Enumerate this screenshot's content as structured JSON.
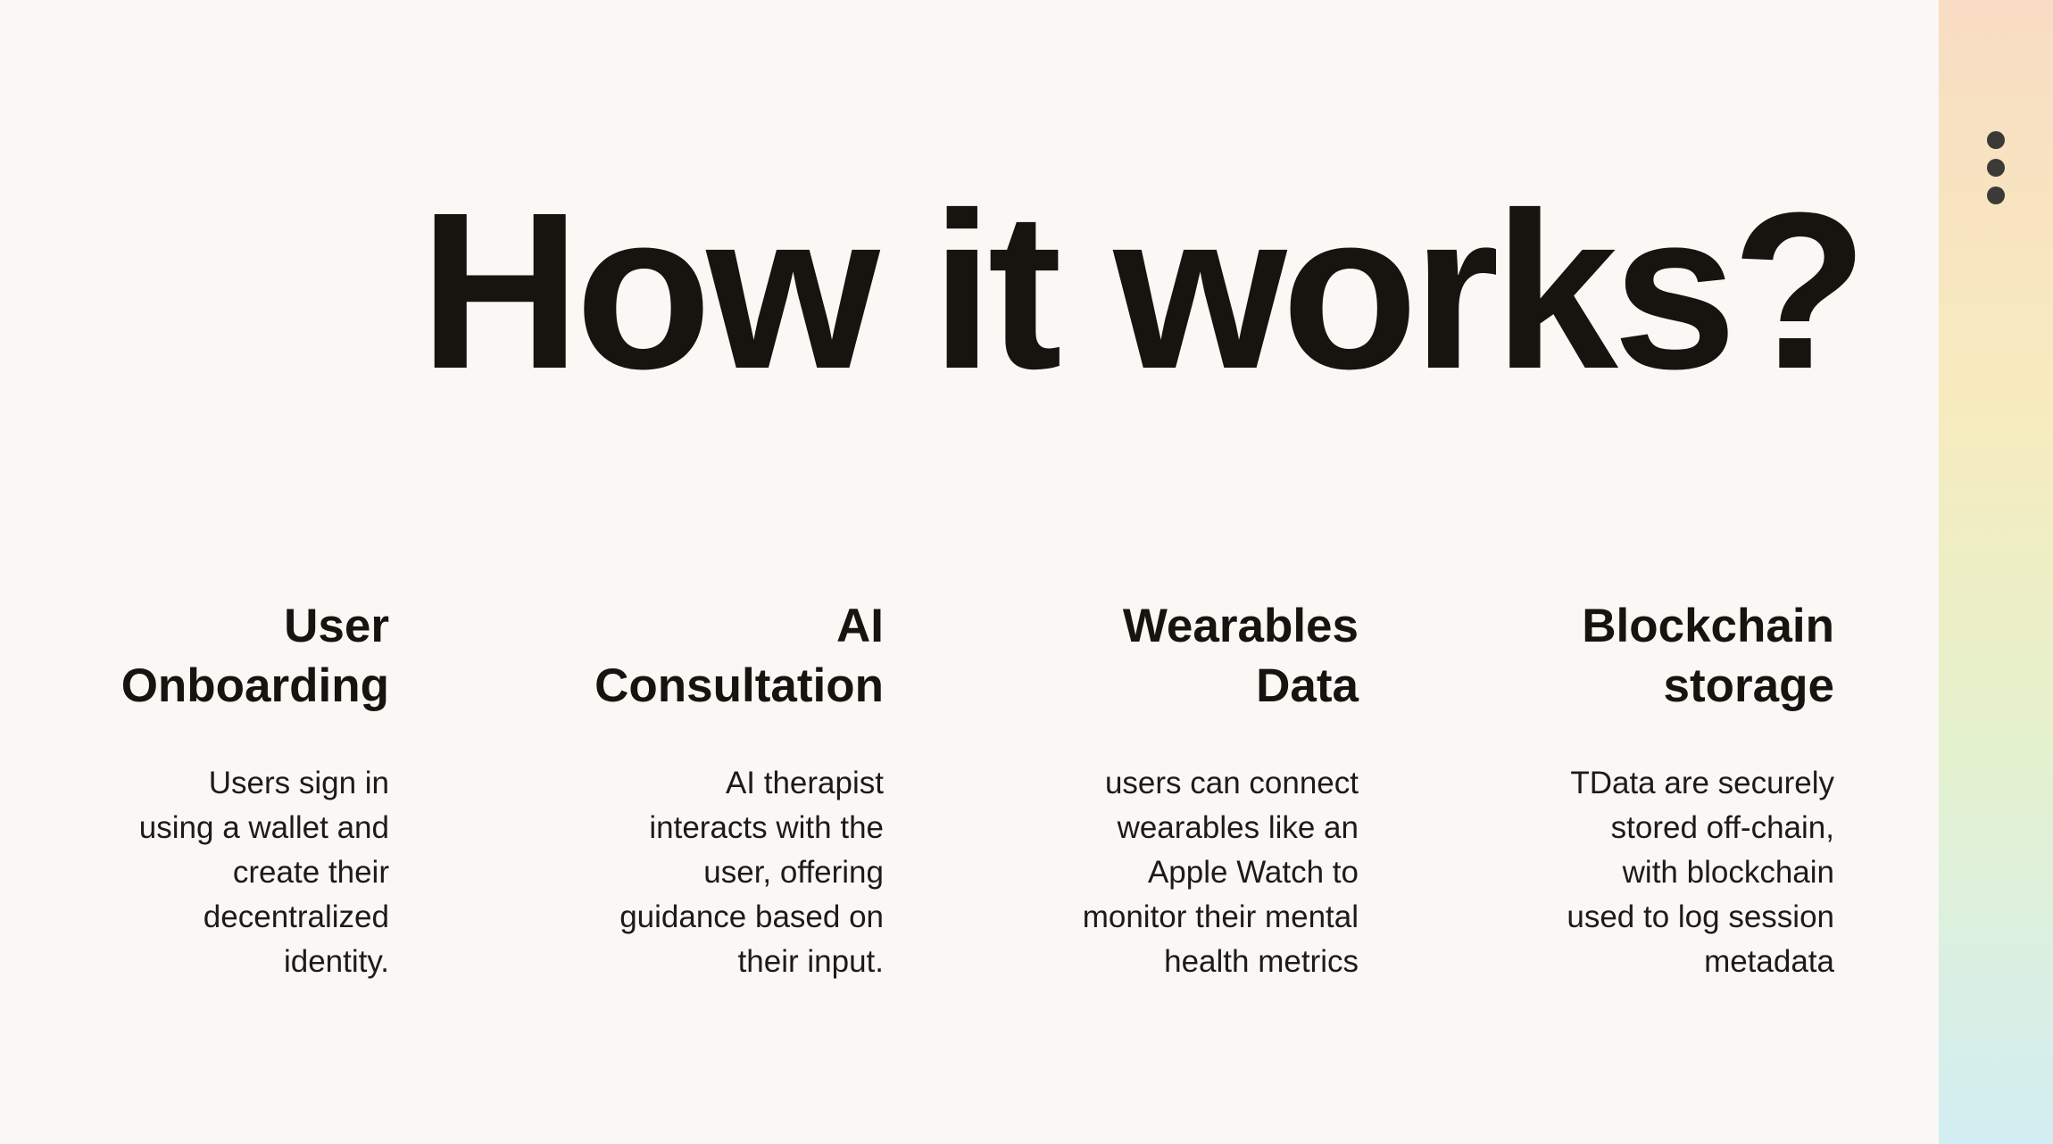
{
  "slide": {
    "title": "How it works?",
    "steps": [
      {
        "title": "User\nOnboarding",
        "description": "Users sign in\nusing a wallet and\ncreate their\ndecentralized\nidentity."
      },
      {
        "title": "AI\nConsultation",
        "description": "AI therapist\ninteracts with the\nuser, offering\nguidance based on\ntheir input."
      },
      {
        "title": "Wearables\nData",
        "description": "users can connect\nwearables like an\nApple Watch to\nmonitor their mental\nhealth metrics"
      },
      {
        "title": "Blockchain\nstorage",
        "description": "TData are securely\nstored off-chain,\nwith blockchain\nused to log session\nmetadata"
      }
    ]
  },
  "menu": {
    "icon": "more-vertical-icon"
  },
  "colors": {
    "background": "#f9f8f4",
    "text": "#16140f",
    "menu_dots": "#3b3a37",
    "strip_gradient": [
      "#f8dcc3",
      "#f7ebbe",
      "#e4f1cd",
      "#d2eef2"
    ]
  }
}
